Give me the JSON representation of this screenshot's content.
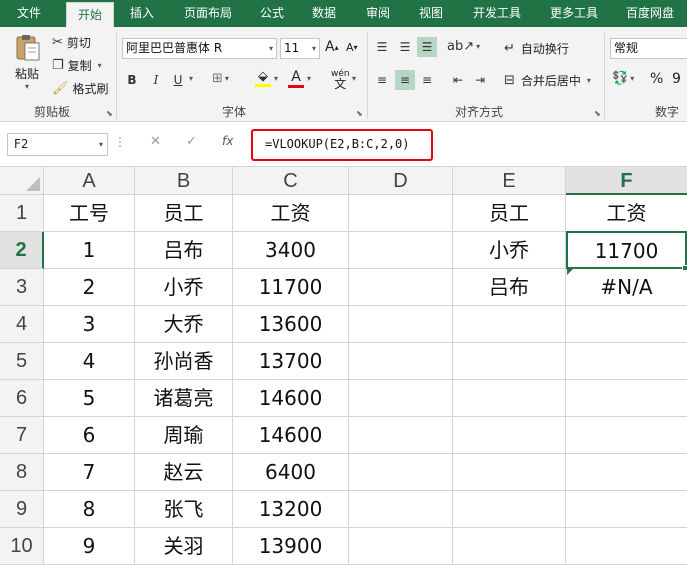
{
  "tabs": [
    "文件",
    "开始",
    "插入",
    "页面布局",
    "公式",
    "数据",
    "审阅",
    "视图",
    "开发工具",
    "更多工具",
    "百度网盘"
  ],
  "ribbon": {
    "clipboard": {
      "paste": "粘贴",
      "cut": "剪切",
      "copy": "复制",
      "format_painter": "格式刷",
      "label": "剪贴板"
    },
    "font": {
      "name": "阿里巴巴普惠体 R",
      "size": "11",
      "grow": "A",
      "shrink": "A",
      "bold": "B",
      "italic": "I",
      "underline": "U",
      "font_color_letter": "A",
      "phonetic": "wén",
      "label": "字体"
    },
    "alignment": {
      "wrap_text": "自动换行",
      "merge_center": "合并后居中",
      "label": "对齐方式"
    },
    "number": {
      "format": "常规",
      "percent": "%",
      "comma": "9",
      "label": "数字"
    }
  },
  "formula_bar": {
    "name_box": "F2",
    "cancel": "✕",
    "confirm": "✓",
    "fx": "fx",
    "formula": "=VLOOKUP(E2,B:C,2,0)"
  },
  "grid": {
    "columns": [
      "A",
      "B",
      "C",
      "D",
      "E",
      "F"
    ],
    "selected_column": "F",
    "rows": [
      {
        "num": "1",
        "cells": [
          "工号",
          "员工",
          "工资",
          "",
          "员工",
          "工资"
        ]
      },
      {
        "num": "2",
        "cells": [
          "1",
          "吕布",
          "3400",
          "",
          "小乔",
          "11700"
        ]
      },
      {
        "num": "3",
        "cells": [
          "2",
          "小乔",
          "11700",
          "",
          "吕布",
          "#N/A"
        ]
      },
      {
        "num": "4",
        "cells": [
          "3",
          "大乔",
          "13600",
          "",
          "",
          ""
        ]
      },
      {
        "num": "5",
        "cells": [
          "4",
          "孙尚香",
          "13700",
          "",
          "",
          ""
        ]
      },
      {
        "num": "6",
        "cells": [
          "5",
          "诸葛亮",
          "14600",
          "",
          "",
          ""
        ]
      },
      {
        "num": "7",
        "cells": [
          "6",
          "周瑜",
          "14600",
          "",
          "",
          ""
        ]
      },
      {
        "num": "8",
        "cells": [
          "7",
          "赵云",
          "6400",
          "",
          "",
          ""
        ]
      },
      {
        "num": "9",
        "cells": [
          "8",
          "张飞",
          "13200",
          "",
          "",
          ""
        ]
      },
      {
        "num": "10",
        "cells": [
          "9",
          "关羽",
          "13900",
          "",
          "",
          ""
        ]
      }
    ],
    "selected_row": "2",
    "active_cell": "F2"
  },
  "colors": {
    "accent": "#217346",
    "highlight": "#e60012",
    "font_color_bar": "#e60012",
    "fill_color_bar": "#ffff00"
  }
}
